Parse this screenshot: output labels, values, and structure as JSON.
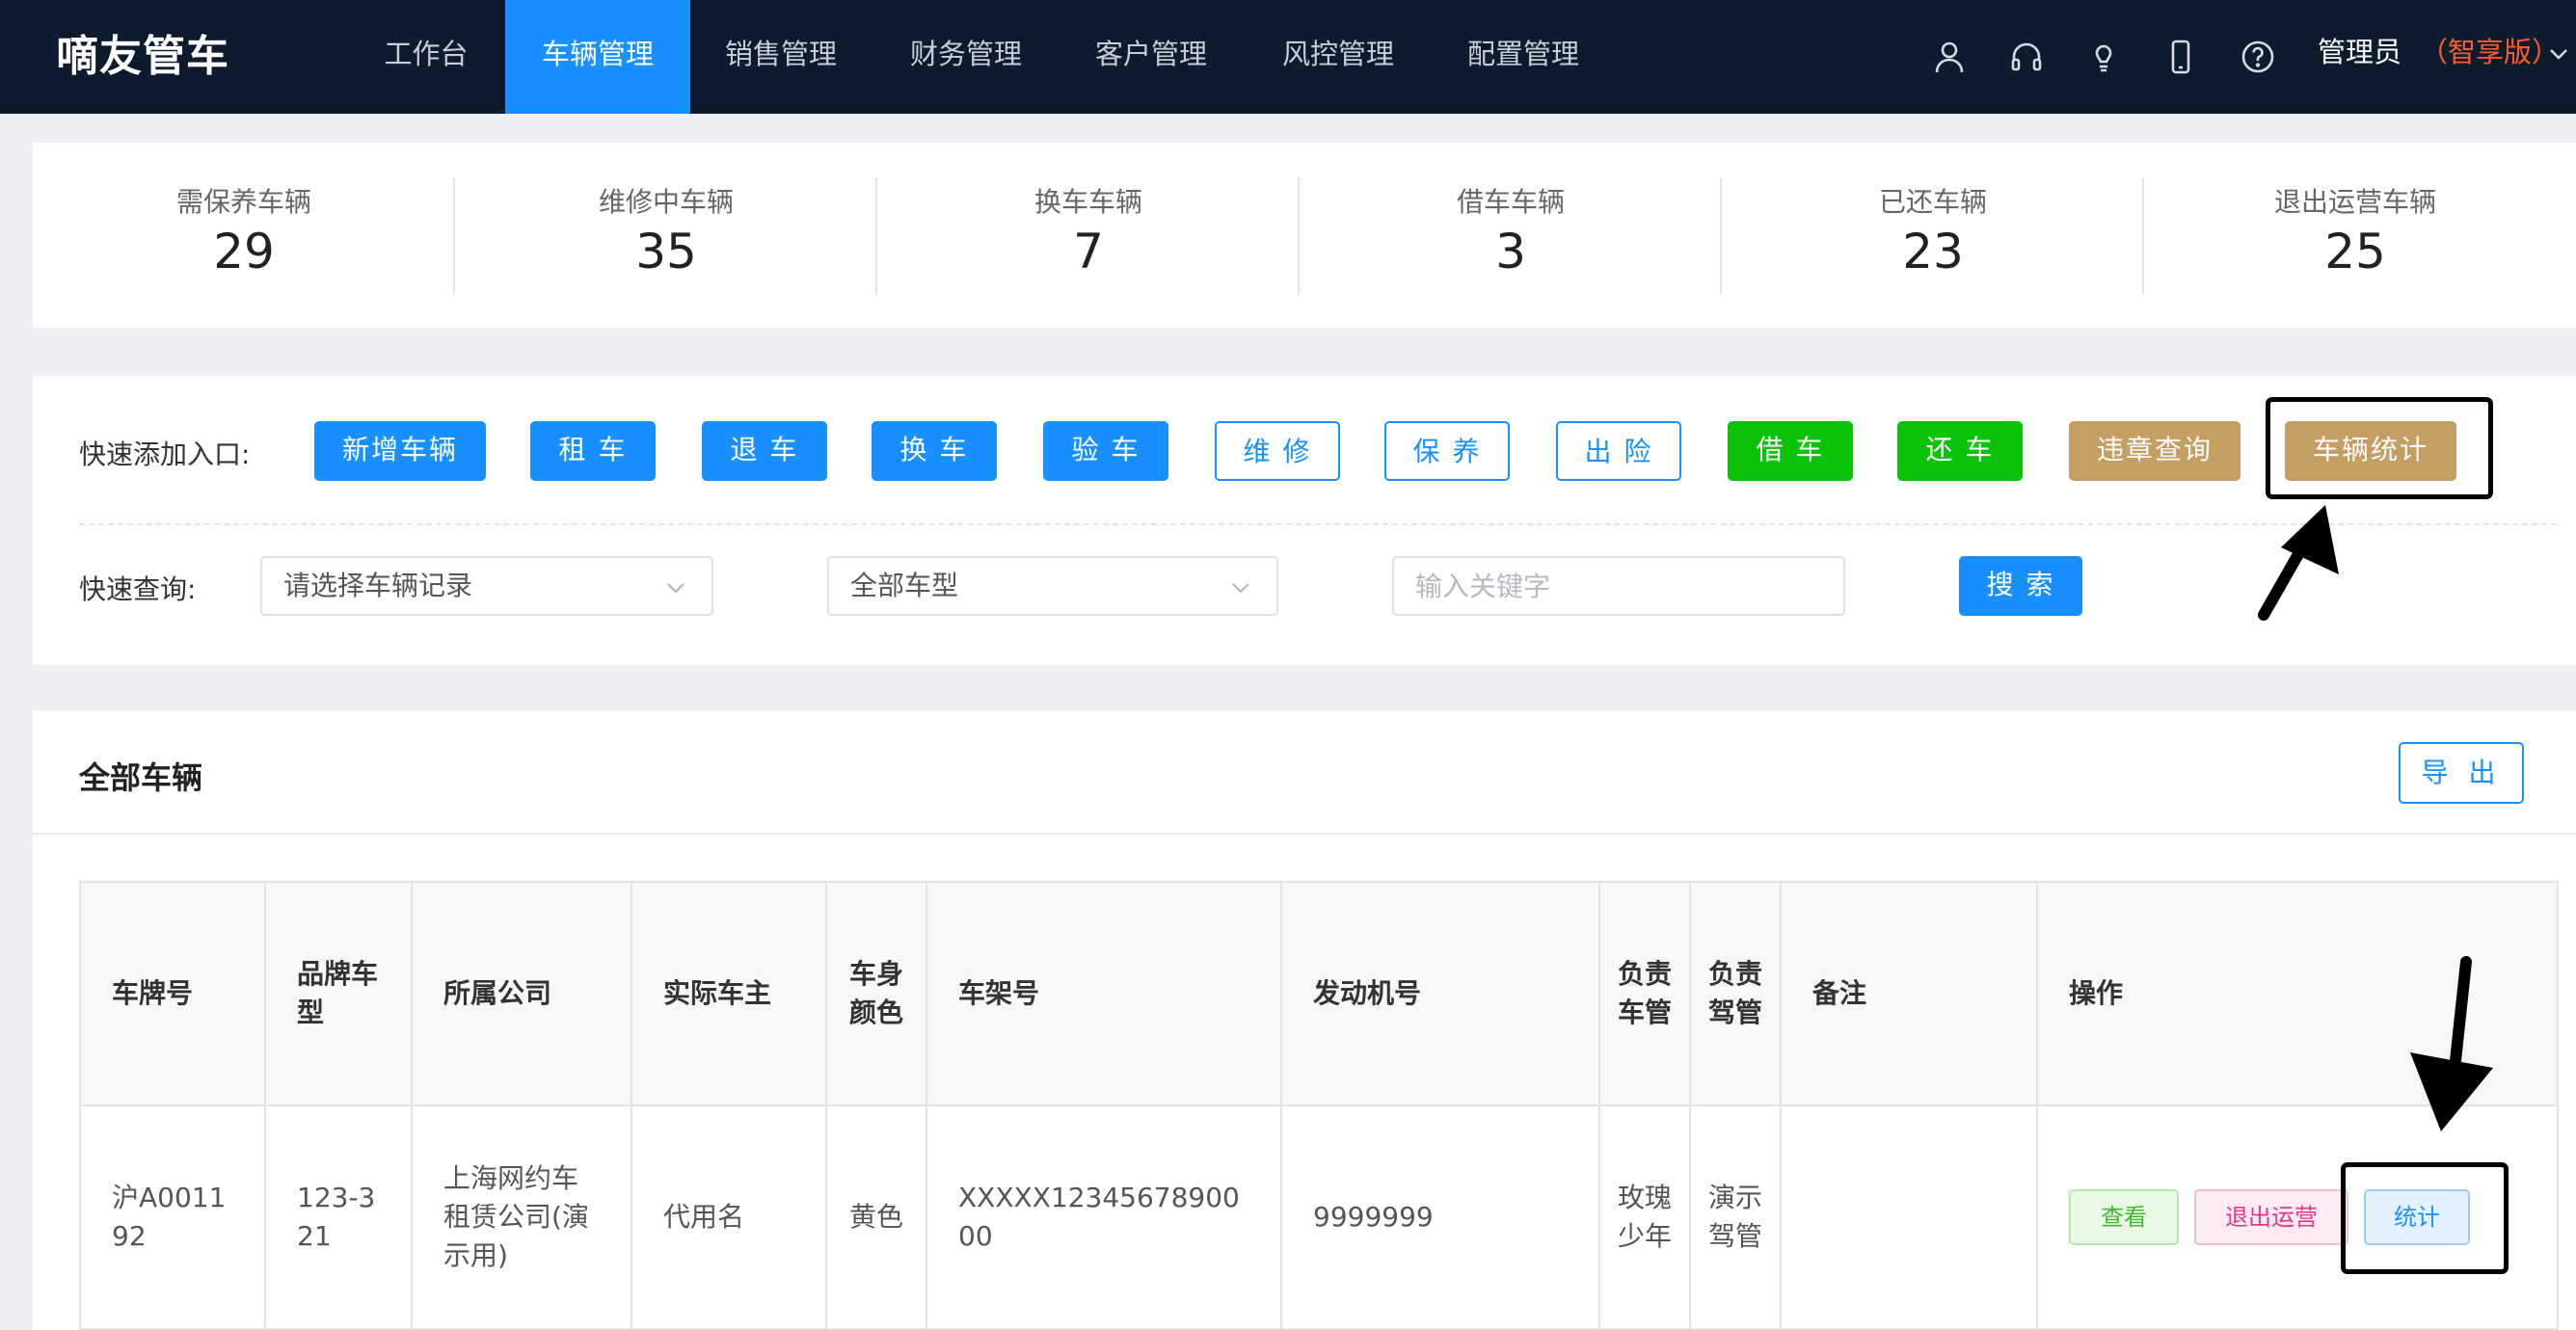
{
  "header": {
    "brand": "嘀友管车",
    "nav": [
      "工作台",
      "车辆管理",
      "销售管理",
      "财务管理",
      "客户管理",
      "风控管理",
      "配置管理"
    ],
    "active_nav": "车辆管理",
    "icons": [
      "user-icon",
      "headset-icon",
      "lightbulb-icon",
      "mobile-icon",
      "help-icon"
    ],
    "user": {
      "role": "管理员",
      "edition": "（智享版）"
    },
    "colors": {
      "bar": "#0d1b2e",
      "active": "#1890ff",
      "edition": "#ff5a2b"
    }
  },
  "stats": [
    {
      "label": "需保养车辆",
      "value": "29"
    },
    {
      "label": "维修中车辆",
      "value": "35"
    },
    {
      "label": "换车车辆",
      "value": "7"
    },
    {
      "label": "借车车辆",
      "value": "3"
    },
    {
      "label": "已还车辆",
      "value": "23"
    },
    {
      "label": "退出运营车辆",
      "value": "25"
    }
  ],
  "quick_add": {
    "label": "快速添加入口:",
    "buttons": [
      {
        "label": "新增车辆",
        "style": "blue"
      },
      {
        "label": "租 车",
        "style": "blue"
      },
      {
        "label": "退 车",
        "style": "blue"
      },
      {
        "label": "换 车",
        "style": "blue"
      },
      {
        "label": "验 车",
        "style": "blue"
      },
      {
        "label": "维 修",
        "style": "outline"
      },
      {
        "label": "保 养",
        "style": "outline"
      },
      {
        "label": "出 险",
        "style": "outline"
      },
      {
        "label": "借 车",
        "style": "green"
      },
      {
        "label": "还 车",
        "style": "green"
      },
      {
        "label": "违章查询",
        "style": "gold"
      },
      {
        "label": "车辆统计",
        "style": "gold"
      }
    ]
  },
  "quick_search": {
    "label": "快速查询:",
    "record_select": "请选择车辆记录",
    "type_select": "全部车型",
    "keyword_placeholder": "输入关键字",
    "search_button": "搜 索"
  },
  "vehicles": {
    "title": "全部车辆",
    "export_button": "导 出",
    "columns": [
      "车牌号",
      "品牌车型",
      "所属公司",
      "实际车主",
      "车身颜色",
      "车架号",
      "发动机号",
      "负责车管",
      "负责驾管",
      "备注",
      "操作"
    ],
    "rows": [
      {
        "plate": "沪A001192",
        "model": "123-321",
        "company": "上海网约车租赁公司(演示用)",
        "owner": "代用名",
        "color": "黄色",
        "vin": "XXXXX1234567890000",
        "engine": "9999999",
        "fleet_manager": "玫瑰少年",
        "driver_manager": "演示驾管",
        "note": "",
        "actions": [
          "查看",
          "退出运营",
          "统计"
        ]
      }
    ]
  }
}
